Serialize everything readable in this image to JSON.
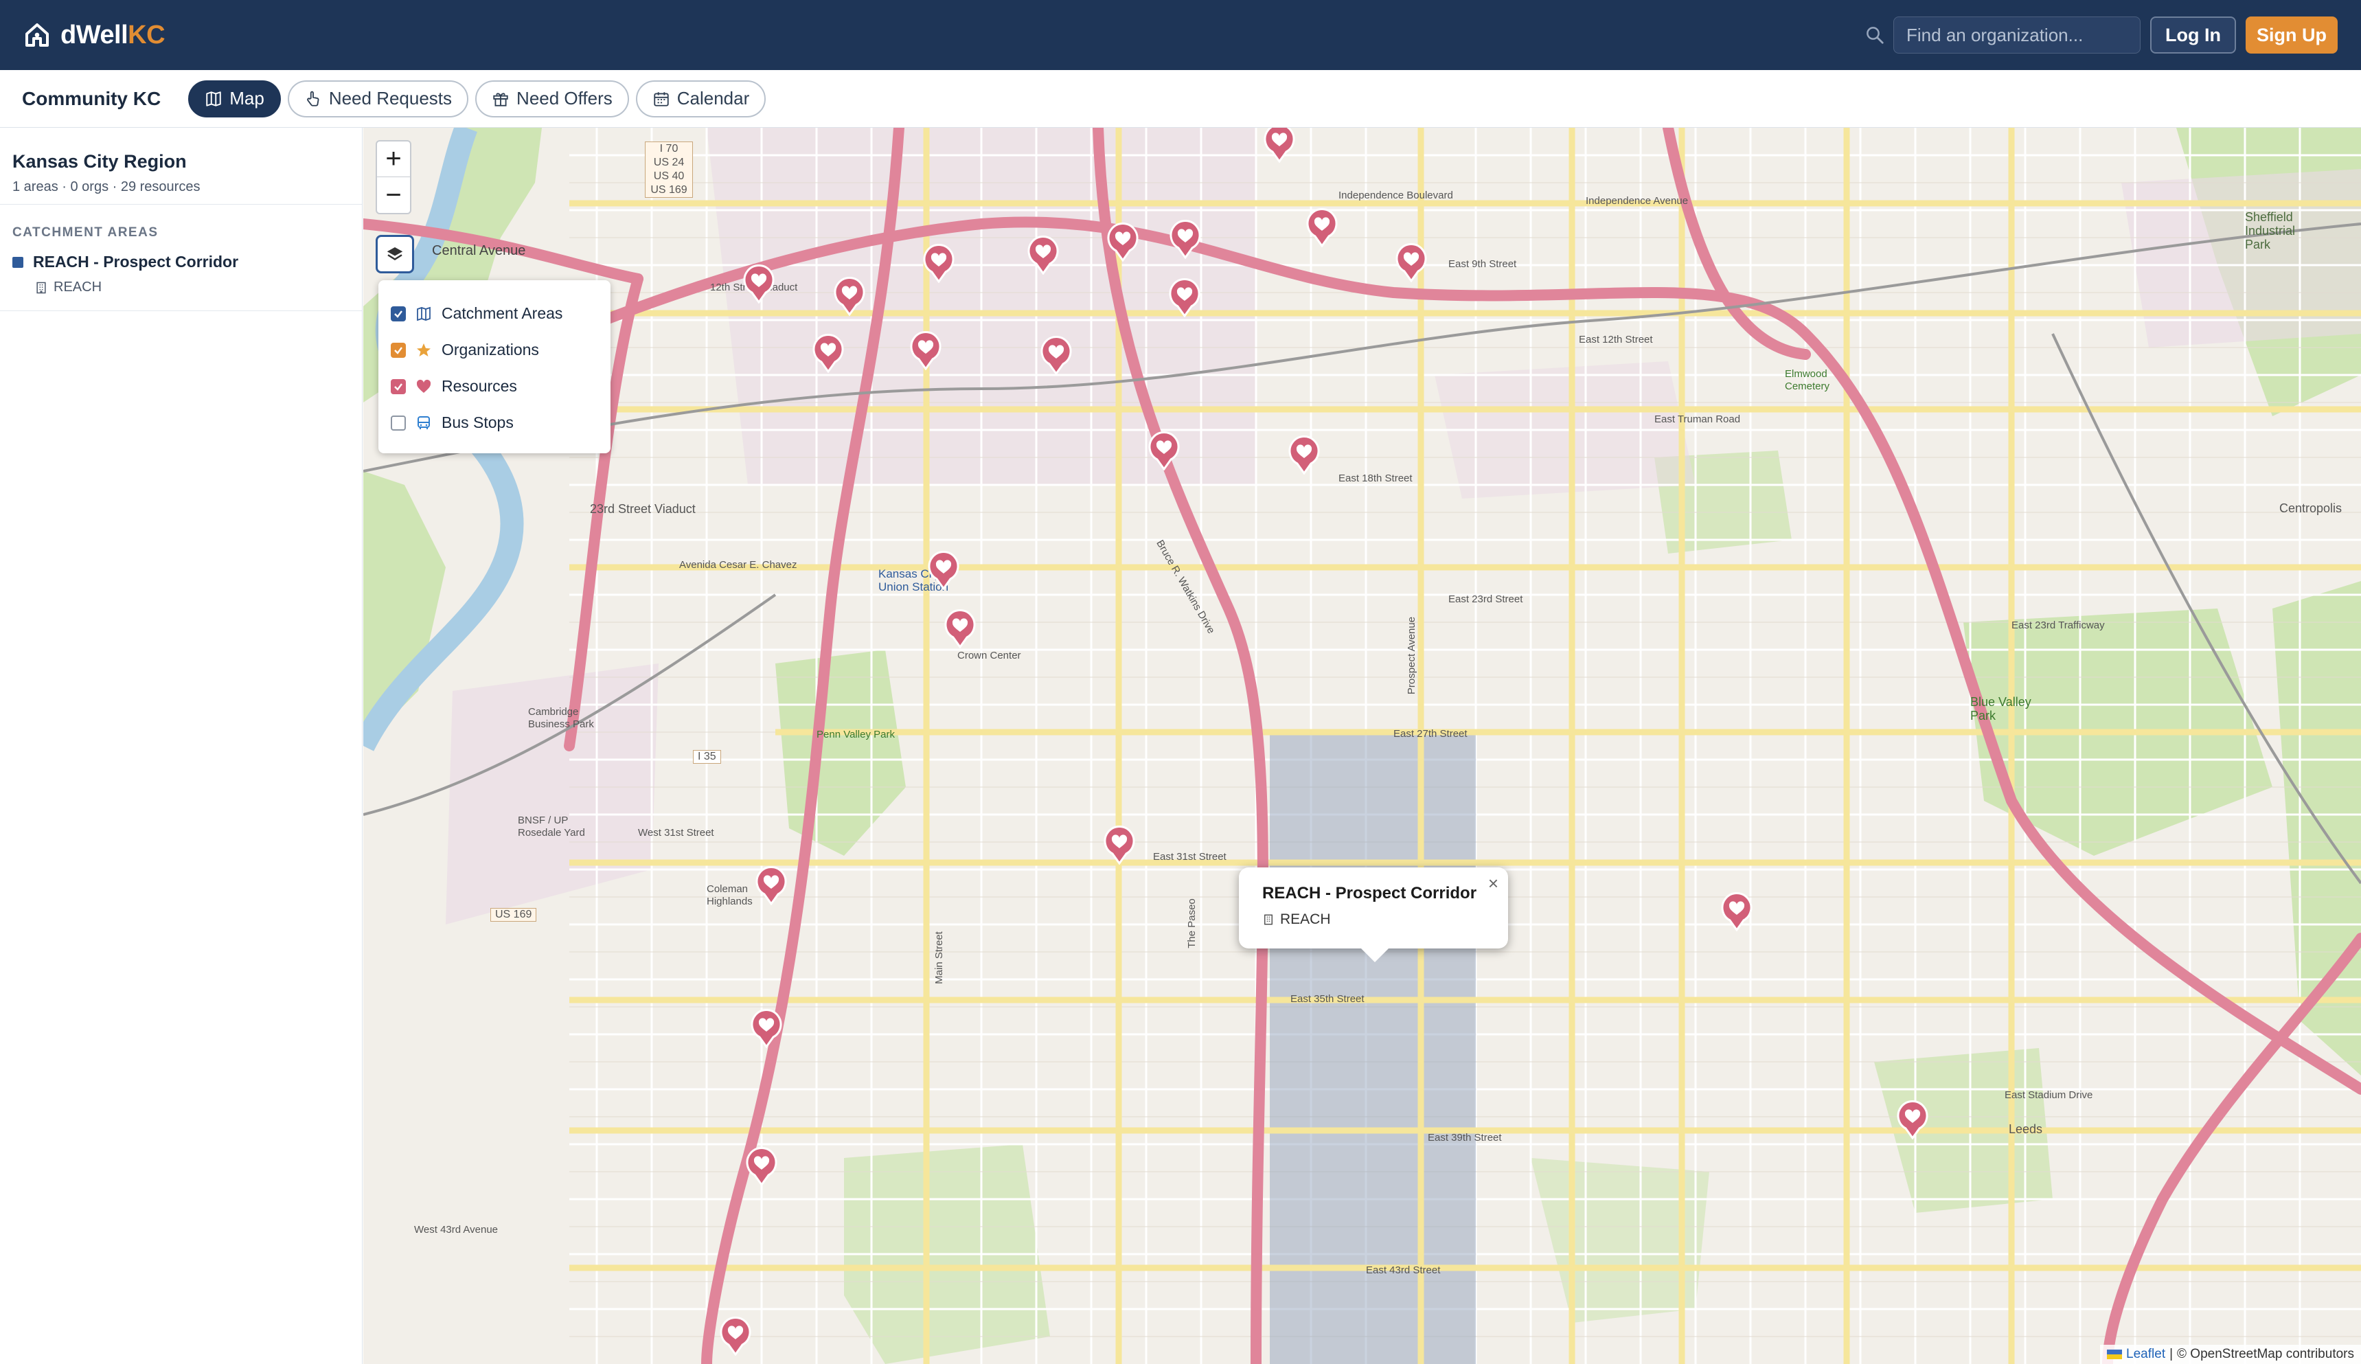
{
  "header": {
    "brand_prefix": "dWell",
    "brand_suffix": "KC",
    "search_placeholder": "Find an organization...",
    "login_label": "Log In",
    "signup_label": "Sign Up",
    "colors": {
      "header_bg": "#1e3557",
      "accent": "#e28d33"
    }
  },
  "subnav": {
    "community": "Community KC",
    "tabs": [
      {
        "label": "Map",
        "icon": "map-icon",
        "active": true
      },
      {
        "label": "Need Requests",
        "icon": "hand-pointer-icon",
        "active": false
      },
      {
        "label": "Need Offers",
        "icon": "gift-icon",
        "active": false
      },
      {
        "label": "Calendar",
        "icon": "calendar-icon",
        "active": false
      }
    ]
  },
  "sidebar": {
    "region_title": "Kansas City Region",
    "region_stats": "1 areas · 0 orgs · 29 resources",
    "section_label": "CATCHMENT AREAS",
    "areas": [
      {
        "name": "REACH - Prospect Corridor",
        "org": "REACH",
        "color": "#2f5b9a"
      }
    ]
  },
  "map": {
    "zoom_in": "+",
    "zoom_out": "−",
    "layers": [
      {
        "label": "Catchment Areas",
        "checked": true,
        "icon": "map-outline-icon"
      },
      {
        "label": "Organizations",
        "checked": true,
        "icon": "star-icon"
      },
      {
        "label": "Resources",
        "checked": true,
        "icon": "heart-icon"
      },
      {
        "label": "Bus Stops",
        "checked": false,
        "icon": "bus-icon"
      }
    ],
    "popup": {
      "title": "REACH - Prospect Corridor",
      "org": "REACH",
      "close": "×"
    },
    "attribution": {
      "leaflet": "Leaflet",
      "separator": "|",
      "osm": "© OpenStreetMap contributors"
    },
    "colors": {
      "marker": "#d25f78",
      "catchment": "#8a9bb8"
    },
    "labels": {
      "central_avenue": "Central Avenue",
      "twelfth_street_viaduct": "12th Street Viaduct",
      "twenty_third_street_viaduct": "23rd Street Viaduct",
      "union_station": "Kansas City Union Station",
      "crown_center": "Crown Center",
      "penn_valley_park": "Penn Valley Park",
      "cambridge_business_park": "Cambridge Business Park",
      "bnsf_rosedale_yard": "BNSF / UP Rosedale Yard",
      "coleman_highlands": "Coleman Highlands",
      "independence_boulevard": "Independence Boulevard",
      "independence_avenue": "Independence Avenue",
      "east_9th_street": "East 9th Street",
      "east_12th_street": "East 12th Street",
      "east_truman_road": "East Truman Road",
      "east_18th_street": "East 18th Street",
      "east_23rd_street": "East 23rd Street",
      "east_23rd_trafficway": "East 23rd Trafficway",
      "east_27th_street": "East 27th Street",
      "east_31st_street": "East 31st Street",
      "east_35th_street": "East 35th Street",
      "east_39th_street": "East 39th Street",
      "east_43rd_street": "East 43rd Street",
      "west_31st_street": "West 31st Street",
      "west_43rd_avenue": "West 43rd Avenue",
      "avenida_cesar_chavez": "Avenida Cesar E. Chavez",
      "main_street": "Main Street",
      "the_paseo": "The Paseo",
      "prospect_avenue": "Prospect Avenue",
      "bruce_watkins_drive": "Bruce R. Watkins Drive",
      "sheffield_park": "Sheffield Industrial Park",
      "elmwood_cemetery": "Elmwood Cemetery",
      "blue_valley_park": "Blue Valley Park",
      "leeds": "Leeds",
      "centropolis": "Centropolis",
      "east_stadium_drive": "East Stadium Drive",
      "i70": "I 70",
      "us24": "US 24",
      "us40": "US 40",
      "us169": "US 169",
      "i35": "I 35",
      "us169_south": "US 169"
    }
  }
}
